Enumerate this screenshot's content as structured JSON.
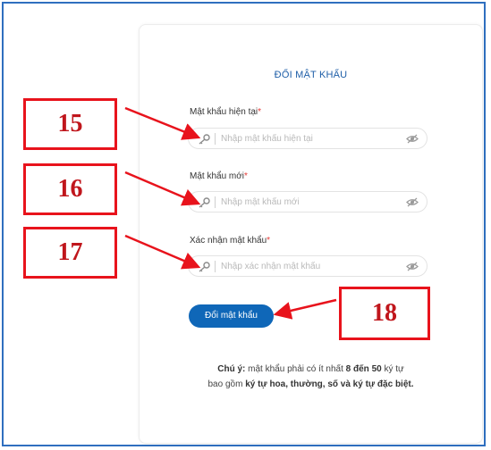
{
  "form": {
    "title": "ĐỔI MẬT KHẨU",
    "required_mark": "*",
    "fields": [
      {
        "label": "Mật khẩu hiện tại",
        "placeholder": "Nhập mật khẩu hiện tại",
        "value": ""
      },
      {
        "label": "Mật khẩu mới",
        "placeholder": "Nhập mật khẩu mới",
        "value": ""
      },
      {
        "label": "Xác nhận mật khẩu",
        "placeholder": "Nhập xác nhận mật khẩu",
        "value": ""
      }
    ],
    "submit_label": "Đổi mật khẩu",
    "note": {
      "prefix": "Chú ý:",
      "text1": " mật khẩu phải có ít nhất ",
      "range": "8 đến 50",
      "text2": " ký tự",
      "text3": "bao gồm ",
      "emphasis": "ký tự hoa, thường, số và ký tự đặc biệt."
    }
  },
  "annotations": [
    "15",
    "16",
    "17",
    "18"
  ],
  "icons": {
    "field_left": "key-icon",
    "field_right": "eye-slash-icon"
  },
  "colors": {
    "title": "#1f5fa8",
    "button": "#0f67b8",
    "annotation": "#e8131c",
    "required": "#e53935",
    "frame": "#2f6fbf"
  }
}
